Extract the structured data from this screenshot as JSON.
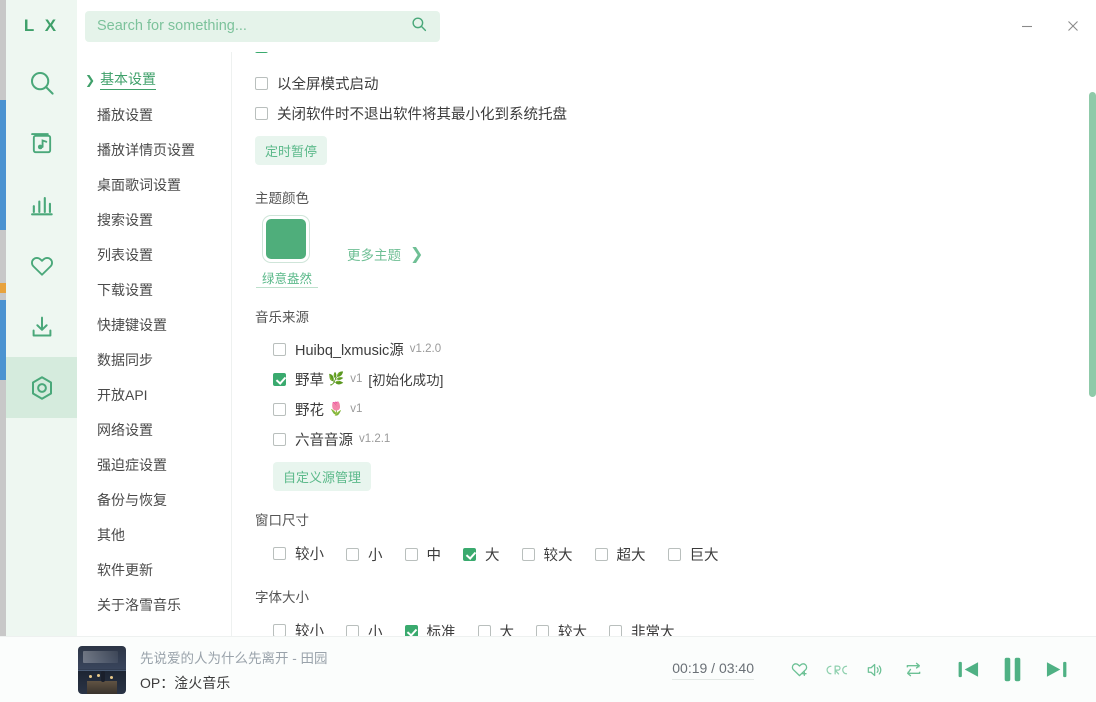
{
  "app": {
    "brand": "L X"
  },
  "search": {
    "placeholder": "Search for something...",
    "value": "",
    "icon": "search-icon"
  },
  "window_controls": {
    "minimize": "minimize-icon",
    "close": "close-icon"
  },
  "rail": {
    "items": [
      {
        "name": "search",
        "icon": "search-icon",
        "active": false
      },
      {
        "name": "song-list",
        "icon": "music-list-icon",
        "active": false
      },
      {
        "name": "leaderboard",
        "icon": "bar-chart-icon",
        "active": false
      },
      {
        "name": "favorites",
        "icon": "heart-icon",
        "active": false
      },
      {
        "name": "download",
        "icon": "download-icon",
        "active": false
      },
      {
        "name": "settings",
        "icon": "gear-hexagon-icon",
        "active": true
      }
    ]
  },
  "settings_nav": {
    "items": [
      {
        "label": "基本设置",
        "active": true
      },
      {
        "label": "播放设置",
        "active": false
      },
      {
        "label": "播放详情页设置",
        "active": false
      },
      {
        "label": "桌面歌词设置",
        "active": false
      },
      {
        "label": "搜索设置",
        "active": false
      },
      {
        "label": "列表设置",
        "active": false
      },
      {
        "label": "下载设置",
        "active": false
      },
      {
        "label": "快捷键设置",
        "active": false
      },
      {
        "label": "数据同步",
        "active": false
      },
      {
        "label": "开放API",
        "active": false
      },
      {
        "label": "网络设置",
        "active": false
      },
      {
        "label": "强迫症设置",
        "active": false
      },
      {
        "label": "备份与恢复",
        "active": false
      },
      {
        "label": "其他",
        "active": false
      },
      {
        "label": "软件更新",
        "active": false
      },
      {
        "label": "关于洛雪音乐",
        "active": false
      }
    ]
  },
  "main": {
    "startup": {
      "cut_off_label": "",
      "options": [
        {
          "label": "以全屏模式启动",
          "checked": false
        },
        {
          "label": "关闭软件时不退出软件将其最小化到系统托盘",
          "checked": false
        }
      ],
      "timer_button": "定时暂停"
    },
    "theme": {
      "title": "主题颜色",
      "selected_name": "绿意盎然",
      "selected_color": "#4fae7b",
      "more_label": "更多主题",
      "more_arrow": "chevron-right-icon"
    },
    "music_source": {
      "title": "音乐来源",
      "items": [
        {
          "label": "Huibq_lxmusic源",
          "emoji": "",
          "version": "v1.2.0",
          "status": "",
          "checked": false
        },
        {
          "label": "野草",
          "emoji": "🌿",
          "version": "v1",
          "status": "[初始化成功]",
          "checked": true
        },
        {
          "label": "野花",
          "emoji": "🌷",
          "version": "v1",
          "status": "",
          "checked": false
        },
        {
          "label": "六音音源",
          "emoji": "",
          "version": "v1.2.1",
          "status": "",
          "checked": false
        }
      ],
      "manage_button": "自定义源管理"
    },
    "window_size": {
      "title": "窗口尺寸",
      "options": [
        {
          "label": "较小",
          "checked": false
        },
        {
          "label": "小",
          "checked": false
        },
        {
          "label": "中",
          "checked": false
        },
        {
          "label": "大",
          "checked": true
        },
        {
          "label": "较大",
          "checked": false
        },
        {
          "label": "超大",
          "checked": false
        },
        {
          "label": "巨大",
          "checked": false
        }
      ]
    },
    "font_size": {
      "title": "字体大小",
      "options": [
        {
          "label": "较小",
          "checked": false
        },
        {
          "label": "小",
          "checked": false
        },
        {
          "label": "标准",
          "checked": true
        },
        {
          "label": "大",
          "checked": false
        },
        {
          "label": "较大",
          "checked": false
        },
        {
          "label": "非常大",
          "checked": false
        }
      ]
    }
  },
  "player": {
    "title": "先说爱的人为什么先离开 - 田园",
    "subtitle": "OP：淦火音乐",
    "current_time": "00:19",
    "total_time": "03:40",
    "time_display": "00:19 / 03:40",
    "controls": [
      {
        "name": "favorite",
        "icon": "heart-plus-icon"
      },
      {
        "name": "lyrics",
        "icon": "lrc-icon"
      },
      {
        "name": "volume",
        "icon": "volume-icon"
      },
      {
        "name": "repeat",
        "icon": "repeat-icon"
      },
      {
        "name": "previous",
        "icon": "previous-icon"
      },
      {
        "name": "pause",
        "icon": "pause-icon"
      },
      {
        "name": "next",
        "icon": "next-icon"
      }
    ]
  },
  "colors": {
    "accent": "#3fa06a",
    "accent_light": "#6cc195",
    "rail_bg": "#eef7f1",
    "checkbox_checked": "#3aaa6e"
  }
}
